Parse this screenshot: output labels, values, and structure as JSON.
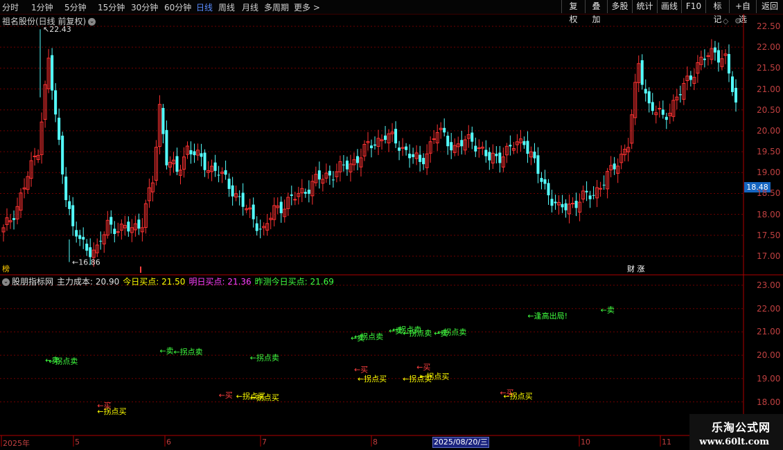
{
  "toolbar": {
    "periods": [
      "分时",
      "1分钟",
      "5分钟",
      "15分钟",
      "30分钟",
      "60分钟",
      "日线",
      "周线",
      "月线",
      "多周期",
      "更多 >"
    ],
    "active_period": "日线",
    "right_buttons": [
      "复权",
      "叠加",
      "多股",
      "统计",
      "画线",
      "F10",
      "标记",
      "+自选",
      "返回"
    ]
  },
  "stock": {
    "title": "祖名股份(日线 前复权)",
    "current_price_tag": "18.48",
    "high_label": "22.43",
    "low_label": "16.86",
    "left_badge": "榜",
    "right_badge": "财 涨"
  },
  "indicator": {
    "name": "股朋指标网",
    "items": [
      {
        "label": "主力成本: 20.90",
        "color": "#e0e0e0"
      },
      {
        "label": "今日买点: 21.50",
        "color": "#ffff00"
      },
      {
        "label": "明日买点: 21.36",
        "color": "#ff40ff"
      },
      {
        "label": "昨测今日买点: 21.69",
        "color": "#40ff40"
      }
    ]
  },
  "axes": {
    "price_ticks": [
      "22.50",
      "22.00",
      "21.50",
      "21.00",
      "20.50",
      "20.00",
      "19.50",
      "19.00",
      "18.50",
      "18.00",
      "17.50",
      "17.00"
    ],
    "indicator_ticks": [
      "23.00",
      "22.00",
      "21.00",
      "20.00",
      "19.00",
      "18.00"
    ],
    "x_labels": [
      "2025年",
      "5",
      "6",
      "7",
      "8",
      "10",
      "11"
    ],
    "cursor_date": "2025/08/20/三"
  },
  "signals": [
    {
      "text": "←卖",
      "kind": "sell",
      "value": 19.8,
      "i": 12
    },
    {
      "text": "←拐点卖",
      "kind": "sell",
      "value": 19.75,
      "i": 13
    },
    {
      "text": "←拐点买",
      "kind": "buy",
      "value": 17.6,
      "i": 27
    },
    {
      "text": "←买",
      "kind": "buy_red",
      "value": 17.85,
      "i": 27
    },
    {
      "text": "←卖",
      "kind": "sell",
      "value": 20.2,
      "i": 45
    },
    {
      "text": "←拐点卖",
      "kind": "sell",
      "value": 20.15,
      "i": 49
    },
    {
      "text": "←买",
      "kind": "buy_red",
      "value": 18.3,
      "i": 62
    },
    {
      "text": "←拐点买",
      "kind": "buy",
      "value": 18.25,
      "i": 67
    },
    {
      "text": "←拐点买",
      "kind": "buy",
      "value": 18.2,
      "i": 71
    },
    {
      "text": "←拐点卖",
      "kind": "sell",
      "value": 19.9,
      "i": 71
    },
    {
      "text": "←卖",
      "kind": "sell",
      "value": 20.75,
      "i": 100
    },
    {
      "text": "←拐点卖",
      "kind": "sell",
      "value": 20.8,
      "i": 101
    },
    {
      "text": "←买",
      "kind": "buy_red",
      "value": 19.4,
      "i": 101
    },
    {
      "text": "←拐点买",
      "kind": "buy",
      "value": 19.0,
      "i": 102
    },
    {
      "text": "←卖",
      "kind": "sell",
      "value": 21.05,
      "i": 111
    },
    {
      "text": "←拐点卖",
      "kind": "sell",
      "value": 21.1,
      "i": 112
    },
    {
      "text": "←拐点卖",
      "kind": "sell",
      "value": 20.95,
      "i": 115
    },
    {
      "text": "←拐点买",
      "kind": "buy",
      "value": 19.0,
      "i": 115
    },
    {
      "text": "←买",
      "kind": "buy_red",
      "value": 19.5,
      "i": 119
    },
    {
      "text": "←拐点买",
      "kind": "buy",
      "value": 19.1,
      "i": 120
    },
    {
      "text": "←卖",
      "kind": "sell",
      "value": 20.95,
      "i": 124
    },
    {
      "text": "←拐点卖",
      "kind": "sell",
      "value": 21.0,
      "i": 125
    },
    {
      "text": "←买",
      "kind": "buy_red",
      "value": 18.4,
      "i": 143
    },
    {
      "text": "←拐点买",
      "kind": "buy",
      "value": 18.25,
      "i": 144
    },
    {
      "text": "←逢高出局!",
      "kind": "sell",
      "value": 21.7,
      "i": 151
    },
    {
      "text": "←卖",
      "kind": "sell",
      "value": 21.95,
      "i": 172
    }
  ],
  "watermark": {
    "line1": "乐淘公式网",
    "line2": "www.60lt.com"
  },
  "colors": {
    "up": "#ff3232",
    "down": "#54ffff",
    "sell": "#40ff40",
    "buy": "#ffff00",
    "buy_red": "#ff4040",
    "grid": "#700000",
    "axis": "#c04040"
  }
}
